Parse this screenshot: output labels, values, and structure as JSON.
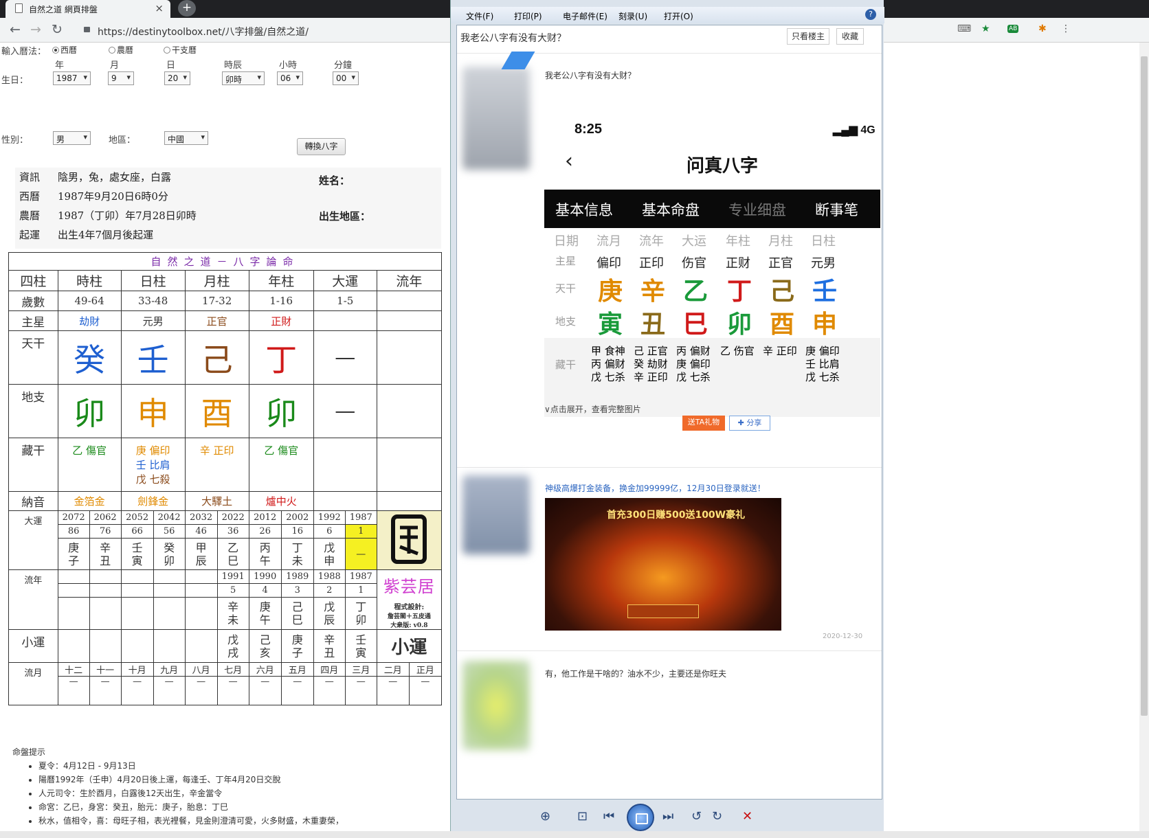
{
  "browser": {
    "tab_title": "自然之道 網頁排盤",
    "url": "https://destinytoolbox.net/八字排盤/自然之道/",
    "ext_abp": "AB"
  },
  "form": {
    "calendar_label": "輸入曆法：",
    "calendar_options": [
      "西曆",
      "農曆",
      "干支曆"
    ],
    "col_labels": [
      "年",
      "月",
      "日",
      "時辰",
      "小時",
      "分鐘"
    ],
    "birth_label": "生日：",
    "birth_values": [
      "1987",
      "9",
      "20",
      "卯時",
      "06",
      "00"
    ],
    "gender_label": "性別：",
    "gender_value": "男",
    "region_label": "地區：",
    "region_value": "中國",
    "convert_button": "轉換八字"
  },
  "info": {
    "rows": [
      {
        "k": "資訊",
        "v": "陰男，兔，處女座，白露"
      },
      {
        "k": "西曆",
        "v": "1987年9月20日6時0分"
      },
      {
        "k": "農曆",
        "v": "1987（丁卯）年7月28日卯時"
      },
      {
        "k": "起運",
        "v": "出生4年7個月後起運"
      }
    ],
    "name_label": "姓名：",
    "place_label": "出生地區："
  },
  "chart": {
    "title": "自然之道－八字論命",
    "headers": [
      "四柱",
      "時柱",
      "日柱",
      "月柱",
      "年柱",
      "大運",
      "流年"
    ],
    "age_label": "歲數",
    "ages": [
      "49-64",
      "33-48",
      "17-32",
      "1-16",
      "1-5",
      ""
    ],
    "star_label": "主星",
    "stars": [
      "劫財",
      "元男",
      "正官",
      "正財",
      "",
      ""
    ],
    "tg_label": "天干",
    "tg": [
      "癸",
      "壬",
      "己",
      "丁",
      "—",
      ""
    ],
    "dz_label": "地支",
    "dz": [
      "卯",
      "申",
      "酉",
      "卯",
      "—",
      ""
    ],
    "cg_label": "藏干",
    "cg": [
      [
        "乙 傷官"
      ],
      [
        "庚 偏印",
        "壬 比肩",
        "戊 七殺"
      ],
      [
        "辛 正印"
      ],
      [
        "乙 傷官"
      ]
    ],
    "ny_label": "納音",
    "ny": [
      "金箔金",
      "劍鋒金",
      "大驛土",
      "爐中火"
    ],
    "dy_label": "大運",
    "dy_years": [
      "2072",
      "2062",
      "2052",
      "2042",
      "2032",
      "2022",
      "2012",
      "2002",
      "1992",
      "1987"
    ],
    "dy_ages": [
      "86",
      "76",
      "66",
      "56",
      "46",
      "36",
      "26",
      "16",
      "6",
      "1"
    ],
    "dy_gz": [
      [
        "庚",
        "子"
      ],
      [
        "辛",
        "丑"
      ],
      [
        "壬",
        "寅"
      ],
      [
        "癸",
        "卯"
      ],
      [
        "甲",
        "辰"
      ],
      [
        "乙",
        "巳"
      ],
      [
        "丙",
        "午"
      ],
      [
        "丁",
        "未"
      ],
      [
        "戊",
        "申"
      ],
      [
        "—",
        ""
      ]
    ],
    "ln_label": "流年",
    "ln_years": [
      "1991",
      "1990",
      "1989",
      "1988",
      "1987"
    ],
    "ln_ages": [
      "5",
      "4",
      "3",
      "2",
      "1"
    ],
    "ln_gz": [
      [
        "辛",
        "未"
      ],
      [
        "庚",
        "午"
      ],
      [
        "己",
        "巳"
      ],
      [
        "戊",
        "辰"
      ],
      [
        "丁",
        "卯"
      ]
    ],
    "brand": "紫芸居",
    "credit1": "程式設計:",
    "credit2": "詹芸閣＋五皮通",
    "credit3": "大衆版: v0.8",
    "logo_bottom": "小運",
    "xy_label": "小運",
    "xy_gz": [
      [
        "戊",
        "戌"
      ],
      [
        "己",
        "亥"
      ],
      [
        "庚",
        "子"
      ],
      [
        "辛",
        "丑"
      ],
      [
        "壬",
        "寅"
      ]
    ],
    "ly_label": "流月",
    "ly_months": [
      "十二",
      "十一",
      "十月",
      "九月",
      "八月",
      "七月",
      "六月",
      "五月",
      "四月",
      "三月",
      "二月",
      "正月"
    ],
    "ly_dash": "—"
  },
  "tips": {
    "heading": "命盤提示",
    "items": [
      "夏令：4月12日 - 9月13日",
      "陽曆1992年（壬申）4月20日後上運，每逢壬、丁年4月20日交脫",
      "人元司令：生於酉月，白露後12天出生，辛金當令",
      "命宮：乙巳，身宮：癸丑，胎元：庚子，胎息：丁巳",
      "秋水，值相令，喜：母旺子相，表光裡餐，見金則澄清可愛，火多財盛，木重妻榮，"
    ]
  },
  "viewer": {
    "menus": [
      "文件(F)",
      "打印(P)",
      "电子邮件(E)",
      "刻录(U)",
      "打开(O)"
    ],
    "help": "?",
    "question": "我老公八字有没有大财？",
    "only_author": "只看楼主",
    "collect": "收藏",
    "post1_text": "我老公八字有没有大财？",
    "phone_time": "8:25",
    "phone_signal": "4G",
    "phone_title": "问真八字",
    "phone_tabs": [
      "基本信息",
      "基本命盘",
      "专业细盘",
      "断事笔"
    ],
    "phone_cols": [
      "日期",
      "流月",
      "流年",
      "大运",
      "年柱",
      "月柱",
      "日柱"
    ],
    "phone_star_label": "主星",
    "phone_stars": [
      "偏印",
      "正印",
      "伤官",
      "正财",
      "正官",
      "元男"
    ],
    "phone_tg_label": "天干",
    "phone_tg": [
      "庚",
      "辛",
      "乙",
      "丁",
      "己",
      "壬"
    ],
    "phone_dz_label": "地支",
    "phone_dz": [
      "寅",
      "丑",
      "巳",
      "卯",
      "酉",
      "申"
    ],
    "phone_cg_label": "藏干",
    "phone_cg": [
      [
        "甲 食神",
        "丙 偏财",
        "戊 七杀"
      ],
      [
        "己 正官",
        "癸 劫财",
        "辛 正印"
      ],
      [
        "丙 偏财",
        "庚 偏印",
        "戊 七杀"
      ],
      [
        "乙 伤官"
      ],
      [
        "辛 正印"
      ],
      [
        "庚 偏印",
        "壬 比肩",
        "戊 七杀"
      ]
    ],
    "expand": "∨点击展开，查看完整图片",
    "gift": "送TA礼物",
    "share": "✚ 分享",
    "ad_text": "神级高爆打金装备，换金加99999亿，12月30日登录就送！",
    "ad_banner": "首充300日赚500送100W豪礼",
    "date": "2020-12-30",
    "reply": "有，他工作是干啥的？油水不少，主要还是你旺夫"
  },
  "colors": {
    "water": "#1e5fd0",
    "wood": "#1a8a1a",
    "fire": "#d01a1a",
    "earth": "#8a4a1a",
    "metal": "#e08a00"
  }
}
